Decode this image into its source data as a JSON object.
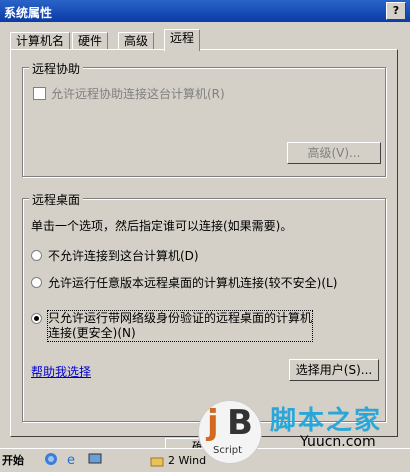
{
  "window": {
    "title": "系统属性",
    "help_button": "?"
  },
  "tabs": [
    {
      "label": "计算机名"
    },
    {
      "label": "硬件"
    },
    {
      "label": "高级"
    },
    {
      "label": "远程",
      "active": true
    }
  ],
  "remote_assistance": {
    "group_title": "远程协助",
    "allow_checkbox_label": "允许远程协助连接这台计算机(R)",
    "allow_checked": false,
    "advanced_button": "高级(V)..."
  },
  "remote_desktop": {
    "group_title": "远程桌面",
    "instruction": "单击一个选项，然后指定谁可以连接(如果需要)。",
    "options": [
      {
        "label": "不允许连接到这台计算机(D)",
        "selected": false
      },
      {
        "label": "允许运行任意版本远程桌面的计算机连接(较不安全)(L)",
        "selected": false
      },
      {
        "label_line1": "只允许运行带网络级身份验证的远程桌面的计算机",
        "label_line2": "连接(更安全)(N)",
        "selected": true
      }
    ],
    "help_link": "帮助我选择",
    "select_users_button": "选择用户(S)..."
  },
  "dialog_buttons": {
    "ok_partial": "确"
  },
  "taskbar": {
    "start": "开始",
    "window_item": "2 Wind"
  },
  "watermark": {
    "logo_letters": "jB",
    "logo_sub": "Script",
    "site_text": "脚本之家",
    "url": "Yuucn.com"
  }
}
